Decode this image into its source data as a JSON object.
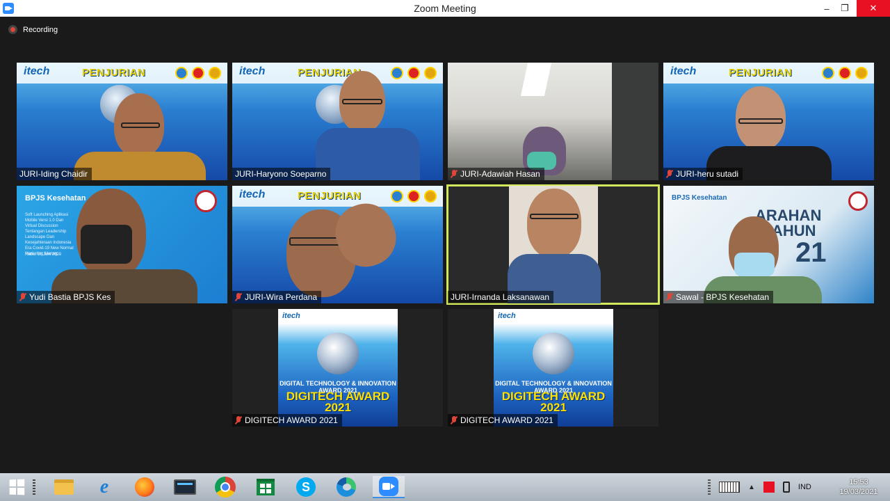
{
  "window": {
    "title": "Zoom Meeting",
    "controls": [
      "–",
      "❐",
      "✕"
    ]
  },
  "recording": {
    "label": "Recording"
  },
  "poster_text": {
    "brand": "itech",
    "penjurian": "PENJURIAN",
    "award_line1": "DIGITAL TECHNOLOGY & INNOVATION AWARD 2021",
    "award_line2": "DIGITECH AWARD 2021"
  },
  "participants": [
    {
      "name": "JURI-Iding Chaidir",
      "muted": false,
      "active": false
    },
    {
      "name": "JURI-Haryono Soeparno",
      "muted": false,
      "active": false
    },
    {
      "name": "JURI-Adawiah Hasan",
      "muted": true,
      "active": false
    },
    {
      "name": "JURI-heru sutadi",
      "muted": true,
      "active": false
    },
    {
      "name": "Yudi Bastia BPJS Kes",
      "muted": true,
      "active": false
    },
    {
      "name": "JURI-Wira Perdana",
      "muted": true,
      "active": false
    },
    {
      "name": "JURI-Irnanda Laksanawan",
      "muted": false,
      "active": true
    },
    {
      "name": "Sawal - BPJS Kesehatan",
      "muted": true,
      "active": false
    },
    {
      "name": "DIGITECH AWARD 2021",
      "muted": true,
      "active": false
    },
    {
      "name": "DIGITECH AWARD 2021",
      "muted": true,
      "active": false
    }
  ],
  "bpjs": {
    "title": "BPJS Kesehatan",
    "slide_text": "Soft Launching Aplikasi Mobile Versi 1.0 Dan Virtual Discussion Tentangan Leadership Landscape Dan Kesejahteraan Indonesia Era Covid-19 New Normal Marketing Manag...",
    "date": "Rabu, 10 Juni 2020"
  },
  "arahan": {
    "line1": "ARAHAN",
    "line2": "AHUN",
    "line3": "21"
  },
  "taskbar": {
    "language": "IND",
    "time": "15:53",
    "date": "19/03/2021",
    "apps": [
      "start-icon",
      "task-view-icon",
      "file-explorer-icon",
      "internet-explorer-icon",
      "firefox-icon",
      "monitor-app-icon",
      "chrome-icon",
      "store-icon",
      "skype-icon",
      "edge-icon",
      "zoom-icon"
    ]
  },
  "colors": {
    "active_speaker": "#d3e85a",
    "muted_mic": "#e0453a",
    "close_button": "#e81123"
  }
}
